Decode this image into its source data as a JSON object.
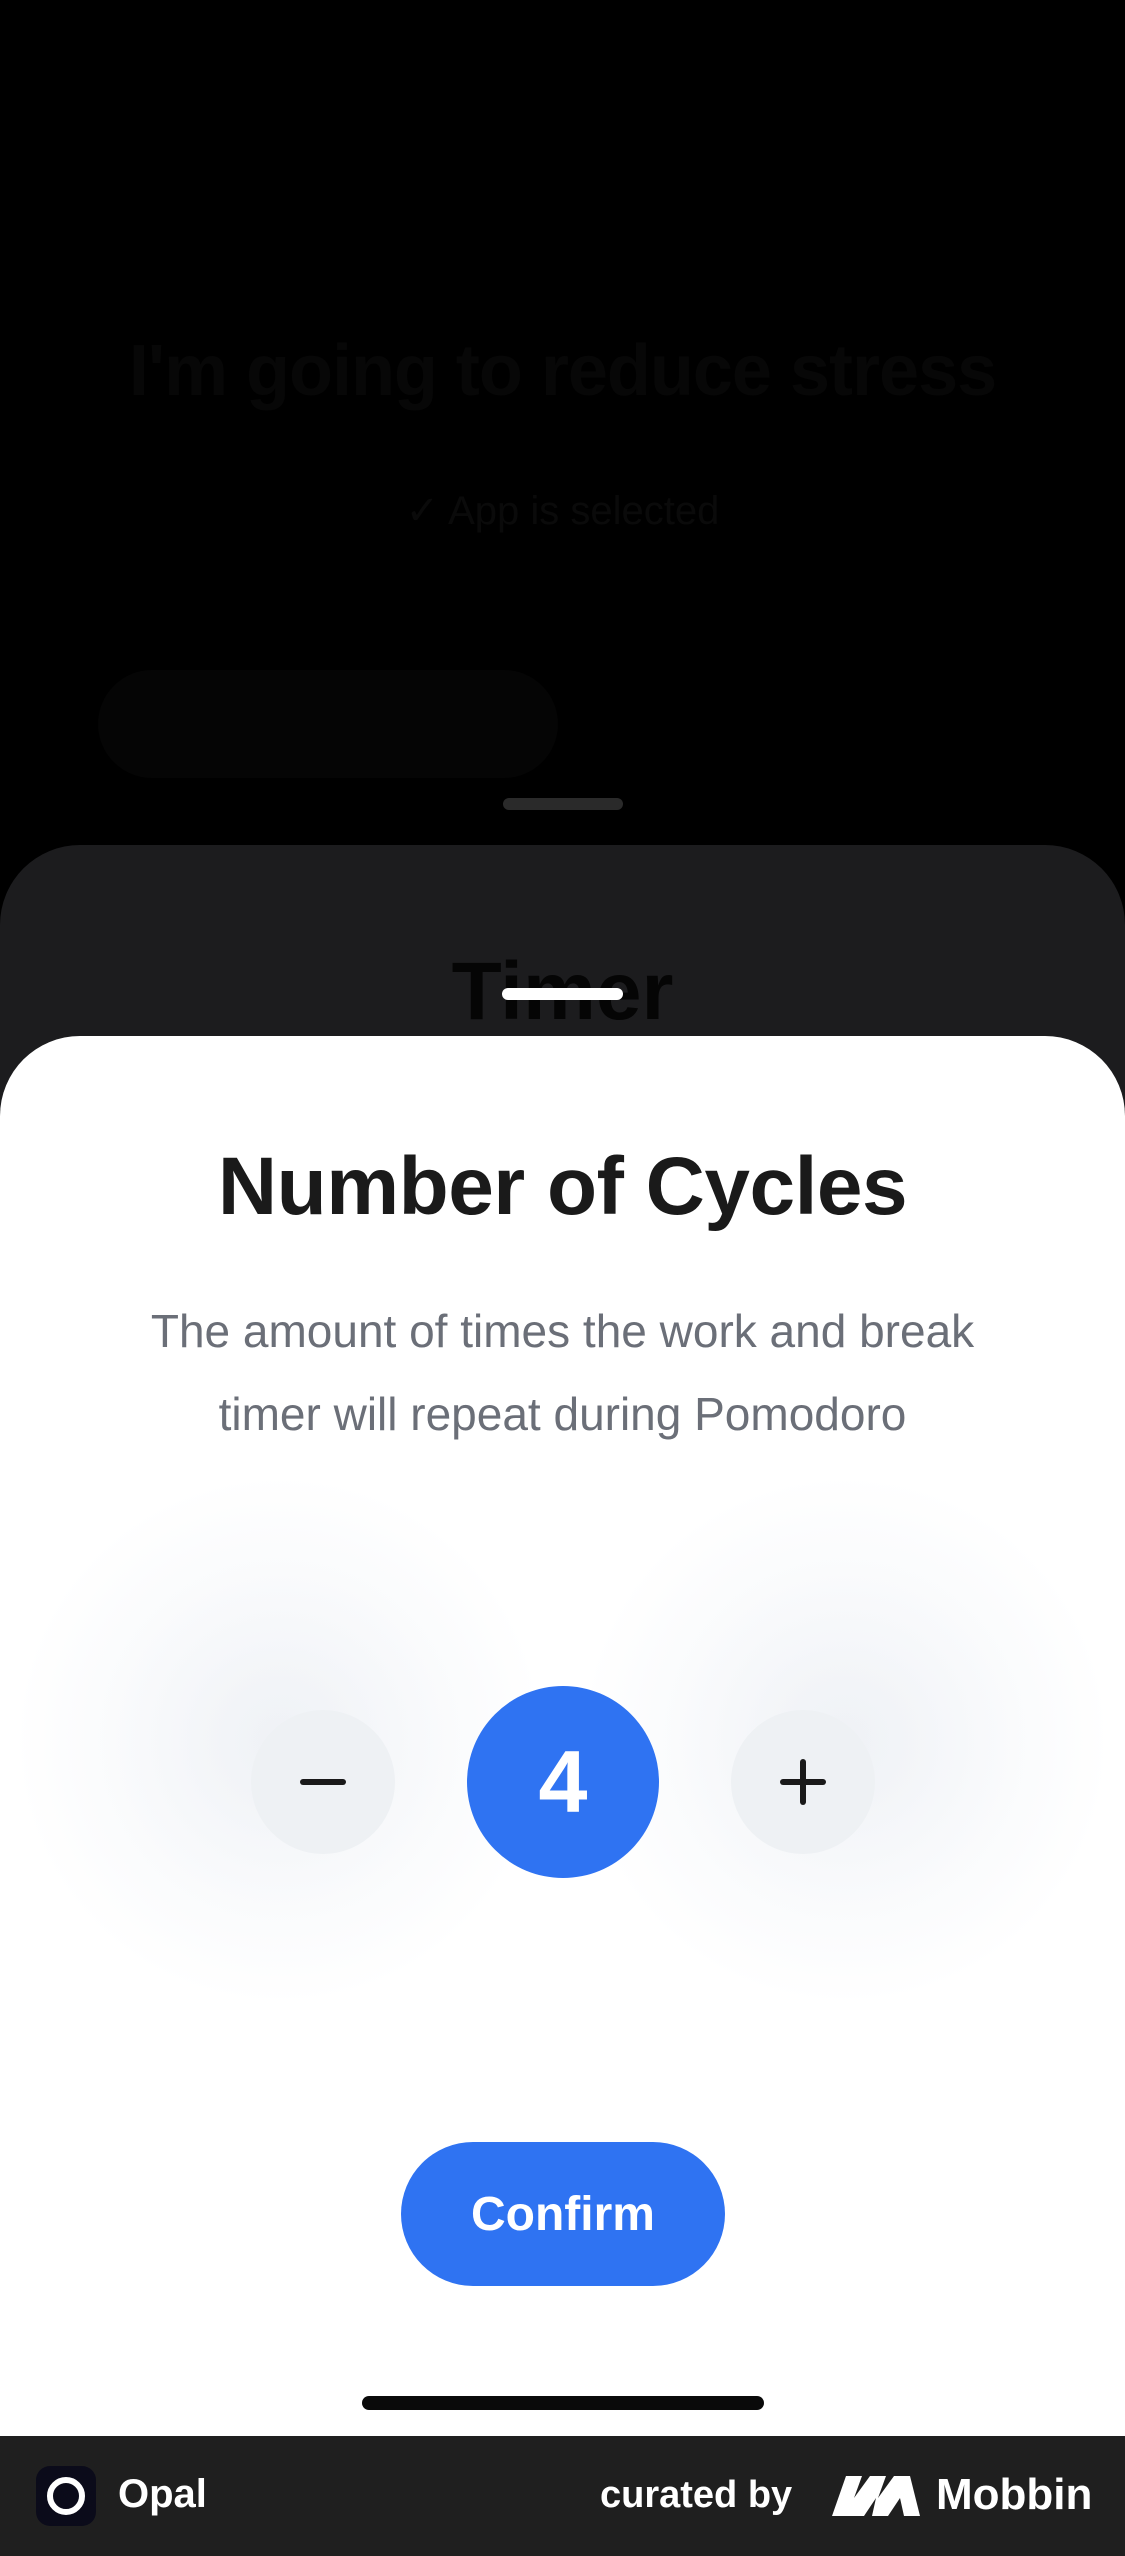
{
  "background": {
    "headline": "I'm going to reduce stress",
    "subtext": "✓ App is selected"
  },
  "timer_sheet": {
    "title": "Timer"
  },
  "cycles_sheet": {
    "title": "Number of Cycles",
    "description": "The amount of times the work and break timer will repeat during Pomodoro",
    "value": "4",
    "decrement_icon": "minus-icon",
    "increment_icon": "plus-icon",
    "confirm_label": "Confirm"
  },
  "brand_bar": {
    "app_name": "Opal",
    "curated_label": "curated by",
    "curator_name": "Mobbin"
  },
  "colors": {
    "accent": "#2f73f2",
    "stepper_bg": "#eef1f4",
    "sheet_bg": "#ffffff",
    "dark_sheet_bg": "#1c1c1e"
  }
}
